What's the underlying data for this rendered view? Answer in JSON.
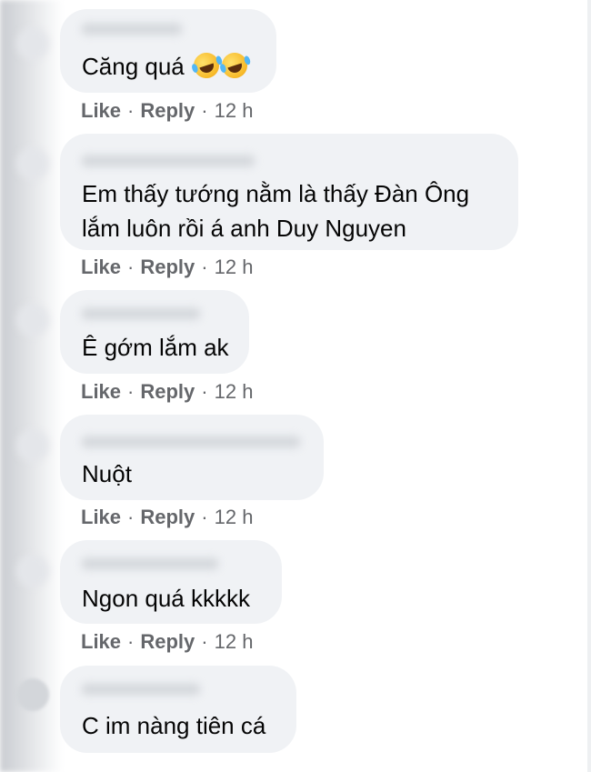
{
  "comments": [
    {
      "text": "Căng quá",
      "emoji": [
        "rolling-on-floor-laughing",
        "rolling-on-floor-laughing"
      ],
      "like": "Like",
      "reply": "Reply",
      "time": "12 h"
    },
    {
      "text_lines": [
        "Em thấy tướng nằm là thấy Đàn Ông",
        "lắm luôn rồi á anh Duy Nguyen"
      ],
      "like": "Like",
      "reply": "Reply",
      "time": "12 h"
    },
    {
      "text": "Ê gớm lắm ak",
      "like": "Like",
      "reply": "Reply",
      "time": "12 h"
    },
    {
      "text": "Nuột",
      "like": "Like",
      "reply": "Reply",
      "time": "12 h"
    },
    {
      "text": "Ngon quá kkkkk",
      "like": "Like",
      "reply": "Reply",
      "time": "12 h"
    },
    {
      "text": "C im nàng tiên cá"
    }
  ],
  "separator": "·",
  "colors": {
    "bubble": "#f0f2f5",
    "text": "#050505",
    "meta": "#65676b"
  }
}
